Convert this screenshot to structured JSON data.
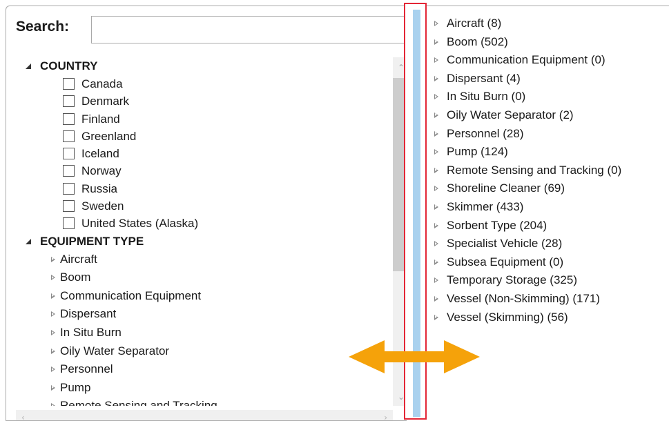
{
  "search": {
    "label": "Search:",
    "value": "",
    "placeholder": ""
  },
  "filter_tree": {
    "country": {
      "label": "COUNTRY",
      "items": [
        {
          "label": "Canada",
          "checked": false
        },
        {
          "label": "Denmark",
          "checked": false
        },
        {
          "label": "Finland",
          "checked": false
        },
        {
          "label": "Greenland",
          "checked": false
        },
        {
          "label": "Iceland",
          "checked": false
        },
        {
          "label": "Norway",
          "checked": false
        },
        {
          "label": "Russia",
          "checked": false
        },
        {
          "label": "Sweden",
          "checked": false
        },
        {
          "label": "United States (Alaska)",
          "checked": false
        }
      ]
    },
    "equipment_type": {
      "label": "EQUIPMENT TYPE",
      "items": [
        {
          "label": "Aircraft"
        },
        {
          "label": "Boom"
        },
        {
          "label": "Communication Equipment"
        },
        {
          "label": "Dispersant"
        },
        {
          "label": "In Situ Burn"
        },
        {
          "label": "Oily Water Separator"
        },
        {
          "label": "Personnel"
        },
        {
          "label": "Pump"
        },
        {
          "label": "Remote Sensing and Tracking"
        }
      ]
    }
  },
  "results_list": [
    {
      "label": "Aircraft (8)"
    },
    {
      "label": "Boom (502)"
    },
    {
      "label": "Communication Equipment (0)"
    },
    {
      "label": "Dispersant (4)"
    },
    {
      "label": "In Situ Burn (0)"
    },
    {
      "label": "Oily Water Separator (2)"
    },
    {
      "label": "Personnel (28)"
    },
    {
      "label": "Pump (124)"
    },
    {
      "label": "Remote Sensing and Tracking (0)"
    },
    {
      "label": "Shoreline Cleaner (69)"
    },
    {
      "label": "Skimmer (433)"
    },
    {
      "label": "Sorbent Type (204)"
    },
    {
      "label": "Specialist Vehicle (28)"
    },
    {
      "label": "Subsea Equipment (0)"
    },
    {
      "label": "Temporary Storage (325)"
    },
    {
      "label": "Vessel (Non-Skimming) (171)"
    },
    {
      "label": "Vessel (Skimming) (56)"
    }
  ],
  "icons": {
    "expanded": "collapse-triangle-icon",
    "collapsed": "expand-triangle-icon",
    "resize": "horizontal-resize-arrow-icon"
  },
  "colors": {
    "splitter": "#a9d1ee",
    "highlight_box": "#e32636",
    "resize_arrow": "#f5a20a",
    "scrollbar_thumb": "#cdcdcd"
  }
}
